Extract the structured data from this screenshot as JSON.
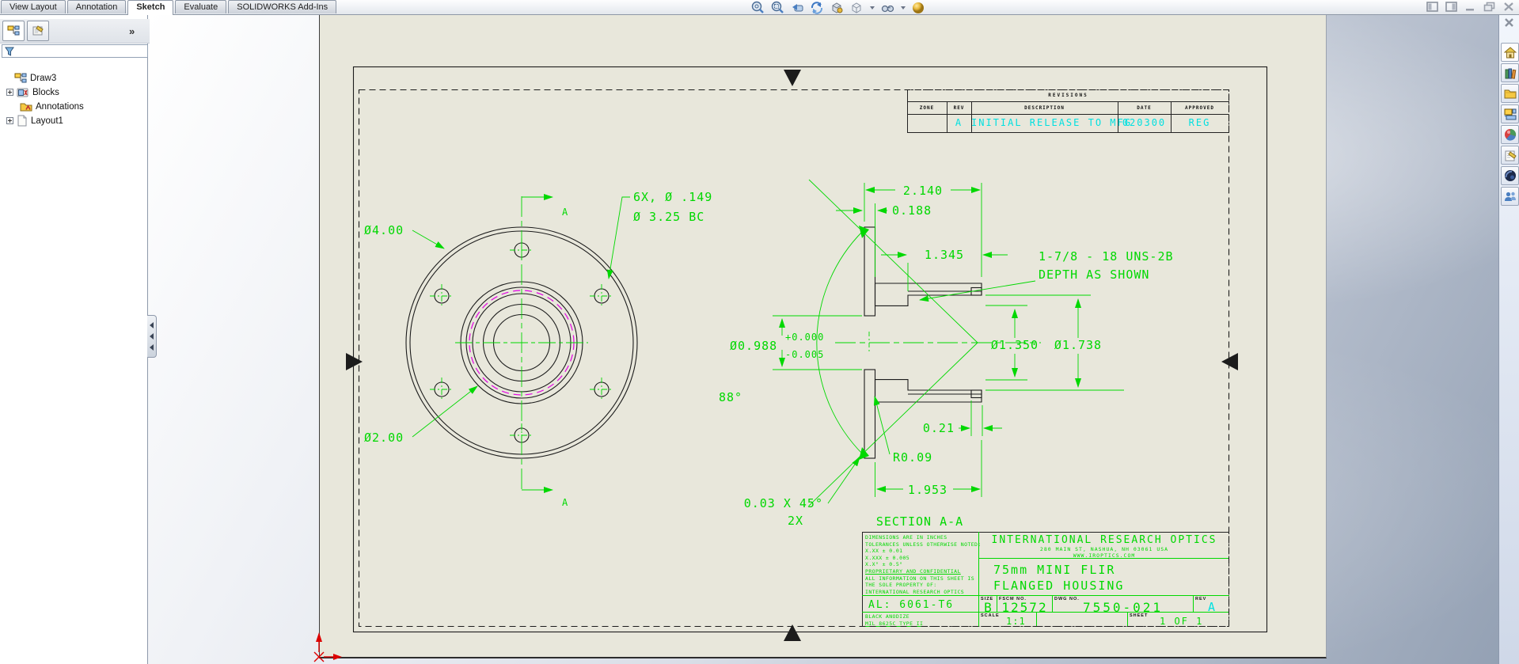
{
  "window": {
    "controls": [
      "pane-left",
      "pane-right",
      "minimize",
      "restore",
      "close"
    ]
  },
  "command_tabs": {
    "items": [
      "View Layout",
      "Annotation",
      "Sketch",
      "Evaluate",
      "SOLIDWORKS Add-Ins"
    ],
    "active": "Sketch"
  },
  "headsup_toolbar": {
    "icons": [
      "zoom-to-fit",
      "zoom-to-area",
      "previous-view",
      "section-view",
      "3d-drawing-view",
      "view-orientation",
      "hide-show-items",
      "edit-appearance"
    ]
  },
  "feature_panel": {
    "tabs": [
      "feature-manager-tree",
      "sheet-properties"
    ],
    "overflow_chevron": "»",
    "filter_value": "",
    "tree": {
      "root": "Draw3",
      "items": [
        {
          "label": "Blocks",
          "expandable": true
        },
        {
          "label": "Annotations",
          "expandable": false
        },
        {
          "label": "Layout1",
          "expandable": true
        }
      ]
    }
  },
  "task_pane": {
    "icons": [
      "close",
      "home",
      "design-library",
      "file-explorer",
      "view-palette",
      "appearances",
      "custom-properties",
      "solidworks-resources",
      "community"
    ]
  },
  "revisions": {
    "title": "REVISIONS",
    "columns": [
      "ZONE",
      "REV",
      "DESCRIPTION",
      "DATE",
      "APPROVED"
    ],
    "rows": [
      {
        "zone": "",
        "rev": "A",
        "description": "INITIAL RELEASE TO MFG",
        "date": "020300",
        "approved": "REG"
      }
    ]
  },
  "drawing": {
    "section_label": "SECTION A-A",
    "section_marker": "A",
    "dia_outer": "Ø4.00",
    "holes_note_line1": "6X, Ø .149",
    "holes_note_line2": "Ø 3.25 BC",
    "dia_counterbore": "Ø2.00",
    "dim_overall_length": "2.140",
    "dim_flange_thickness": "0.188",
    "dim_thread_depth": "1.345",
    "thread_note_line1": "1-7/8 - 18 UNS-2B",
    "thread_note_line2": "DEPTH AS SHOWN",
    "dim_bore": "Ø0.988",
    "bore_tol_plus": "+0.000",
    "bore_tol_minus": "-0.005",
    "dia_mid_bore": "Ø1.350",
    "dia_thread_bore": "Ø1.738",
    "dim_cone_angle": "88°",
    "dim_relief": "0.21",
    "dim_fillet": "R0.09",
    "dim_body_length": "1.953",
    "chamfer_note_line1": "0.03 X 45°",
    "chamfer_note_line2": "2X"
  },
  "title_block": {
    "company": "INTERNATIONAL RESEARCH OPTICS",
    "address": "280 MAIN ST, NASHUA, NH 03061 USA",
    "website": "WWW.IROPTICS.COM",
    "part_title_line1": "75mm MINI FLIR",
    "part_title_line2": "FLANGED HOUSING",
    "material": "AL: 6061-T6",
    "finish_line1": "BLACK ANODIZE",
    "finish_line2": "MIL 8625C TYPE II",
    "size": "B",
    "fscm_no": "12572",
    "dwg_no": "7550-021",
    "rev": "A",
    "scale": "1:1",
    "sheet": "1 OF 1",
    "labels": {
      "size": "SIZE",
      "fscm": "FSCM NO.",
      "dwg": "DWG NO.",
      "rev": "REV",
      "scale": "SCALE",
      "sheet": "SHEET"
    },
    "notes": [
      "DIMENSIONS ARE IN INCHES",
      "TOLERANCES UNLESS OTHERWISE NOTED:",
      "X.XX ± 0.01",
      "X.XXX ± 0.005",
      "X.X° ± 0.5°",
      "PROPRIETARY AND CONFIDENTIAL",
      "ALL INFORMATION ON THIS SHEET IS",
      "THE SOLE PROPERTY OF:",
      "INTERNATIONAL RESEARCH OPTICS"
    ]
  },
  "colors": {
    "annotation_green": "#00d800",
    "revision_cyan": "#00e0e0",
    "thread_magenta": "#e400e4",
    "paper_beige": "#e8e7db"
  }
}
